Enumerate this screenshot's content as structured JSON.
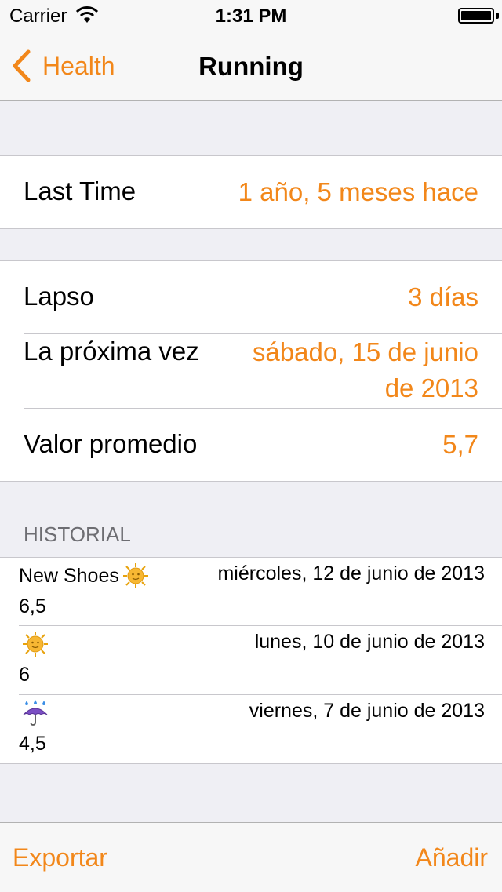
{
  "status_bar": {
    "carrier": "Carrier",
    "time": "1:31 PM"
  },
  "nav": {
    "back_label": "Health",
    "title": "Running"
  },
  "summary": {
    "label": "Last Time",
    "value": "1 año, 5 meses hace"
  },
  "details": {
    "lapse_label": "Lapso",
    "lapse_value": "3 días",
    "next_label": "La próxima vez",
    "next_value_line1": "sábado, 15 de junio",
    "next_value_line2": "de 2013",
    "avg_label": "Valor promedio",
    "avg_value": "5,7"
  },
  "history": {
    "header": "HISTORIAL",
    "items": [
      {
        "note": "New Shoes",
        "icon": "sun-icon",
        "date": "miércoles, 12 de junio de 2013",
        "value": "6,5"
      },
      {
        "note": "",
        "icon": "sun-icon",
        "date": "lunes, 10 de junio de 2013",
        "value": "6"
      },
      {
        "note": "",
        "icon": "umbrella-rain-icon",
        "date": "viernes, 7 de junio de 2013",
        "value": "4,5"
      }
    ]
  },
  "toolbar": {
    "export_label": "Exportar",
    "add_label": "Añadir"
  },
  "colors": {
    "accent": "#f2871a",
    "background": "#efeff4",
    "separator": "#c8c7cc"
  }
}
